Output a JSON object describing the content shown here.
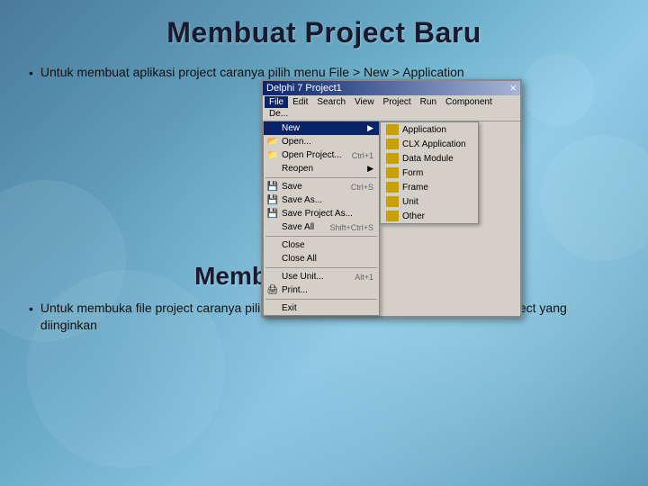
{
  "page": {
    "background_color": "#5a8fa8"
  },
  "header": {
    "title": "Membuat Project Baru"
  },
  "section1": {
    "bullet": "•",
    "text": "Untuk membuat aplikasi  project caranya pilih menu File > New > Application"
  },
  "section2": {
    "title": "Membuka File Project",
    "bullet": "•",
    "text": "Untuk membuka file project caranya pilih menu File > OPEN PROJECT > pilih file project yang diinginkan"
  },
  "delphi": {
    "titlebar": "Delphi 7  Project1",
    "menubar": [
      "File",
      "Edit",
      "Search",
      "View",
      "Project",
      "Run",
      "Component",
      "De..."
    ],
    "file_menu": {
      "items": [
        {
          "label": "New",
          "shortcut": "",
          "arrow": "▶",
          "highlighted": true
        },
        {
          "label": "Open...",
          "shortcut": "",
          "arrow": ""
        },
        {
          "label": "Open Project...",
          "shortcut": "Ctrl+1",
          "arrow": ""
        },
        {
          "label": "Reopen",
          "shortcut": "",
          "arrow": "▶"
        },
        {
          "label": "Save",
          "shortcut": "Ctrl+S",
          "arrow": ""
        },
        {
          "label": "Save As...",
          "shortcut": "",
          "arrow": ""
        },
        {
          "label": "Save Project As...",
          "shortcut": "",
          "arrow": ""
        },
        {
          "label": "Save All",
          "shortcut": "Shift+Ctrl+S",
          "arrow": ""
        },
        {
          "label": "Close",
          "shortcut": "",
          "arrow": ""
        },
        {
          "label": "Close All",
          "shortcut": "",
          "arrow": ""
        },
        {
          "label": "Use Unit...",
          "shortcut": "Alt+1",
          "arrow": ""
        },
        {
          "label": "Print...",
          "shortcut": "",
          "arrow": ""
        },
        {
          "label": "Exit",
          "shortcut": "",
          "arrow": ""
        }
      ]
    },
    "new_submenu": {
      "items": [
        {
          "label": "Application",
          "highlighted": false
        },
        {
          "label": "CLX Application",
          "highlighted": false
        },
        {
          "label": "Data Module",
          "highlighted": false
        },
        {
          "label": "Form",
          "highlighted": false
        },
        {
          "label": "Frame",
          "highlighted": false
        },
        {
          "label": "Unit",
          "highlighted": false
        },
        {
          "label": "Other",
          "highlighted": false
        }
      ]
    }
  }
}
